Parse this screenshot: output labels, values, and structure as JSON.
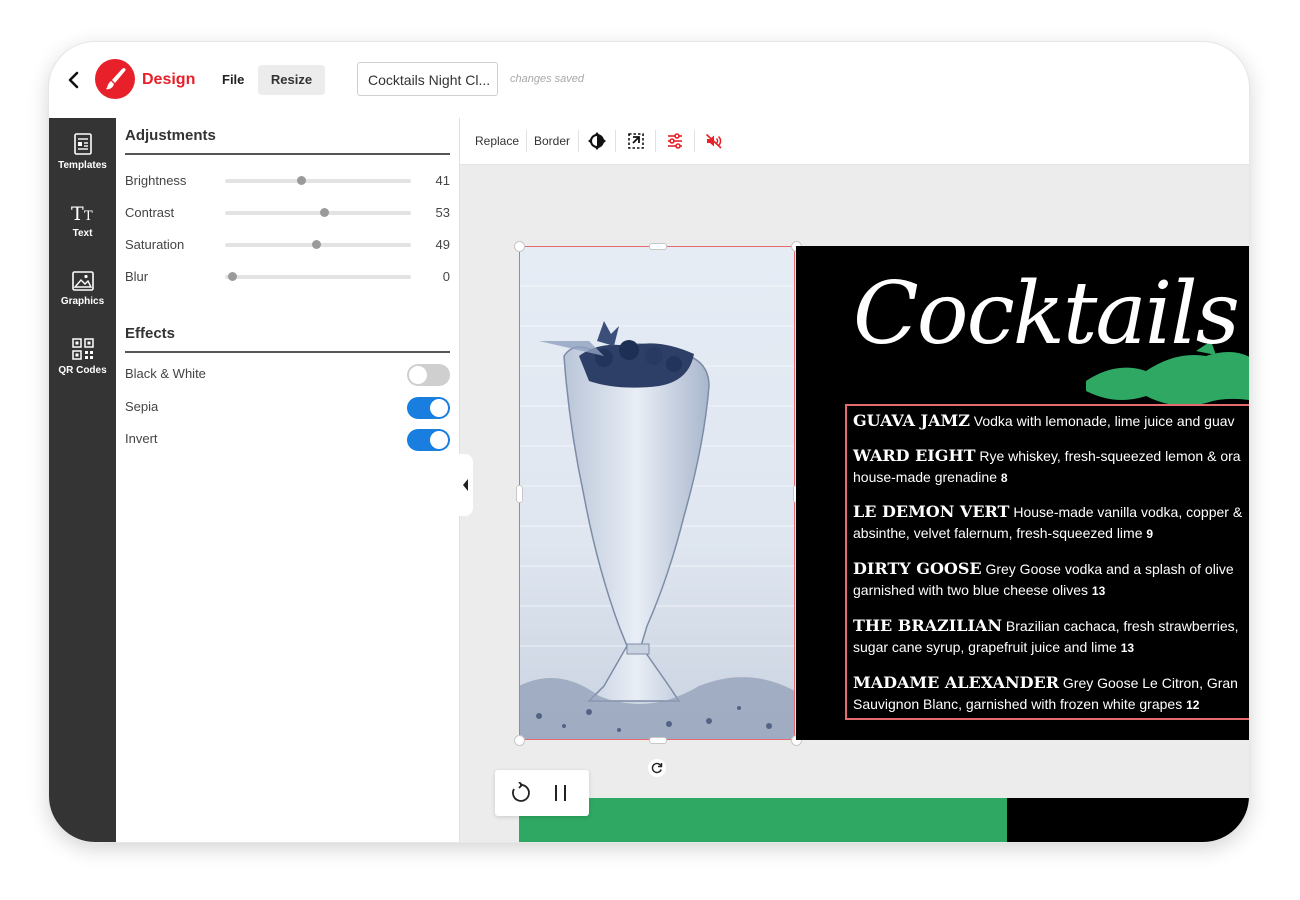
{
  "header": {
    "brand": "Design",
    "file_label": "File",
    "resize_label": "Resize",
    "document_title": "Cocktails Night Cl...",
    "save_status": "changes saved"
  },
  "rail": {
    "items": [
      {
        "label": "Templates",
        "icon": "templates-icon"
      },
      {
        "label": "Text",
        "icon": "text-icon"
      },
      {
        "label": "Graphics",
        "icon": "graphics-icon"
      },
      {
        "label": "QR Codes",
        "icon": "qr-code-icon"
      }
    ]
  },
  "adjustments": {
    "title": "Adjustments",
    "sliders": [
      {
        "label": "Brightness",
        "value": 41
      },
      {
        "label": "Contrast",
        "value": 53
      },
      {
        "label": "Saturation",
        "value": 49
      },
      {
        "label": "Blur",
        "value": 0
      }
    ]
  },
  "effects": {
    "title": "Effects",
    "toggles": [
      {
        "label": "Black & White",
        "on": false
      },
      {
        "label": "Sepia",
        "on": true
      },
      {
        "label": "Invert",
        "on": true
      }
    ]
  },
  "toolbar": {
    "replace_label": "Replace",
    "border_label": "Border",
    "icons": [
      "brightness-icon",
      "crop-icon",
      "adjustments-icon",
      "mute-icon"
    ]
  },
  "menu": {
    "title": "Cocktails",
    "items": [
      {
        "name": "GUAVA JAMZ",
        "line1": "Vodka with lemonade, lime juice and guav",
        "line2": "",
        "price": ""
      },
      {
        "name": "WARD EIGHT",
        "line1": "Rye whiskey, fresh-squeezed lemon & ora",
        "line2": "house-made grenadine",
        "price": "8"
      },
      {
        "name": "LE DEMON VERT",
        "line1": "House-made vanilla vodka, copper &",
        "line2": "absinthe, velvet falernum, fresh-squeezed lime",
        "price": "9"
      },
      {
        "name": "DIRTY GOOSE",
        "line1": "Grey Goose vodka and a splash of olive",
        "line2": "garnished with two blue cheese olives",
        "price": "13"
      },
      {
        "name": "THE BRAZILIAN",
        "line1": "Brazilian cachaca, fresh strawberries,",
        "line2": "sugar cane syrup, grapefruit juice and lime",
        "price": "13"
      },
      {
        "name": "MADAME ALEXANDER",
        "line1": "Grey Goose Le Citron, Gran",
        "line2": "Sauvignon Blanc, garnished with frozen white grapes",
        "price": "12"
      }
    ]
  },
  "colors": {
    "brand_red": "#e8202a",
    "toggle_on": "#1a7de0",
    "selection": "#e56b70",
    "accent_green": "#2ea862"
  }
}
